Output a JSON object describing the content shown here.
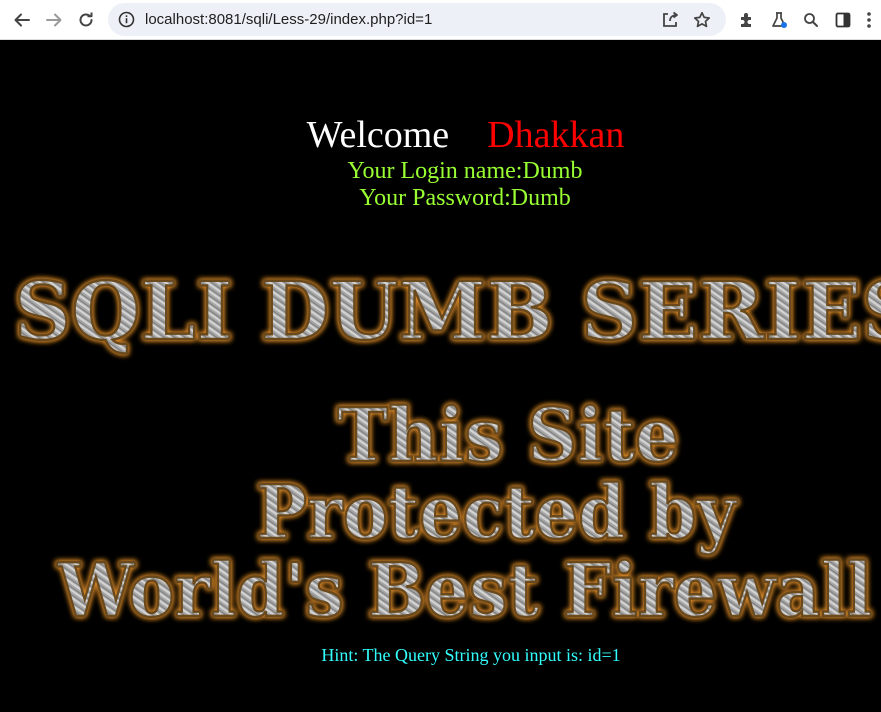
{
  "browser": {
    "url": "localhost:8081/sqli/Less-29/index.php?id=1"
  },
  "page": {
    "welcome_word": "Welcome",
    "welcome_name": "Dhakkan",
    "login_name_line": "Your Login name:Dumb",
    "password_line": "Your Password:Dumb",
    "banner_title": "SQLI DUMB SERIES",
    "firewall_line1": "This Site",
    "firewall_line2": "Protected by",
    "firewall_line3": "World's Best Firewall",
    "hint": "Hint: The Query String you input is: id=1"
  },
  "colors": {
    "background": "#000000",
    "welcome": "#ffffff",
    "name": "#ff0000",
    "credentials": "#99ff33",
    "hint": "#33ffff",
    "banner_glow": "#e8912a"
  },
  "icons": [
    "back-arrow-icon",
    "forward-arrow-icon",
    "reload-icon",
    "site-info-icon",
    "share-icon",
    "bookmark-star-icon",
    "extensions-puzzle-icon",
    "lab-flask-icon",
    "zoom-search-icon",
    "side-panel-icon",
    "more-vert-icon"
  ]
}
